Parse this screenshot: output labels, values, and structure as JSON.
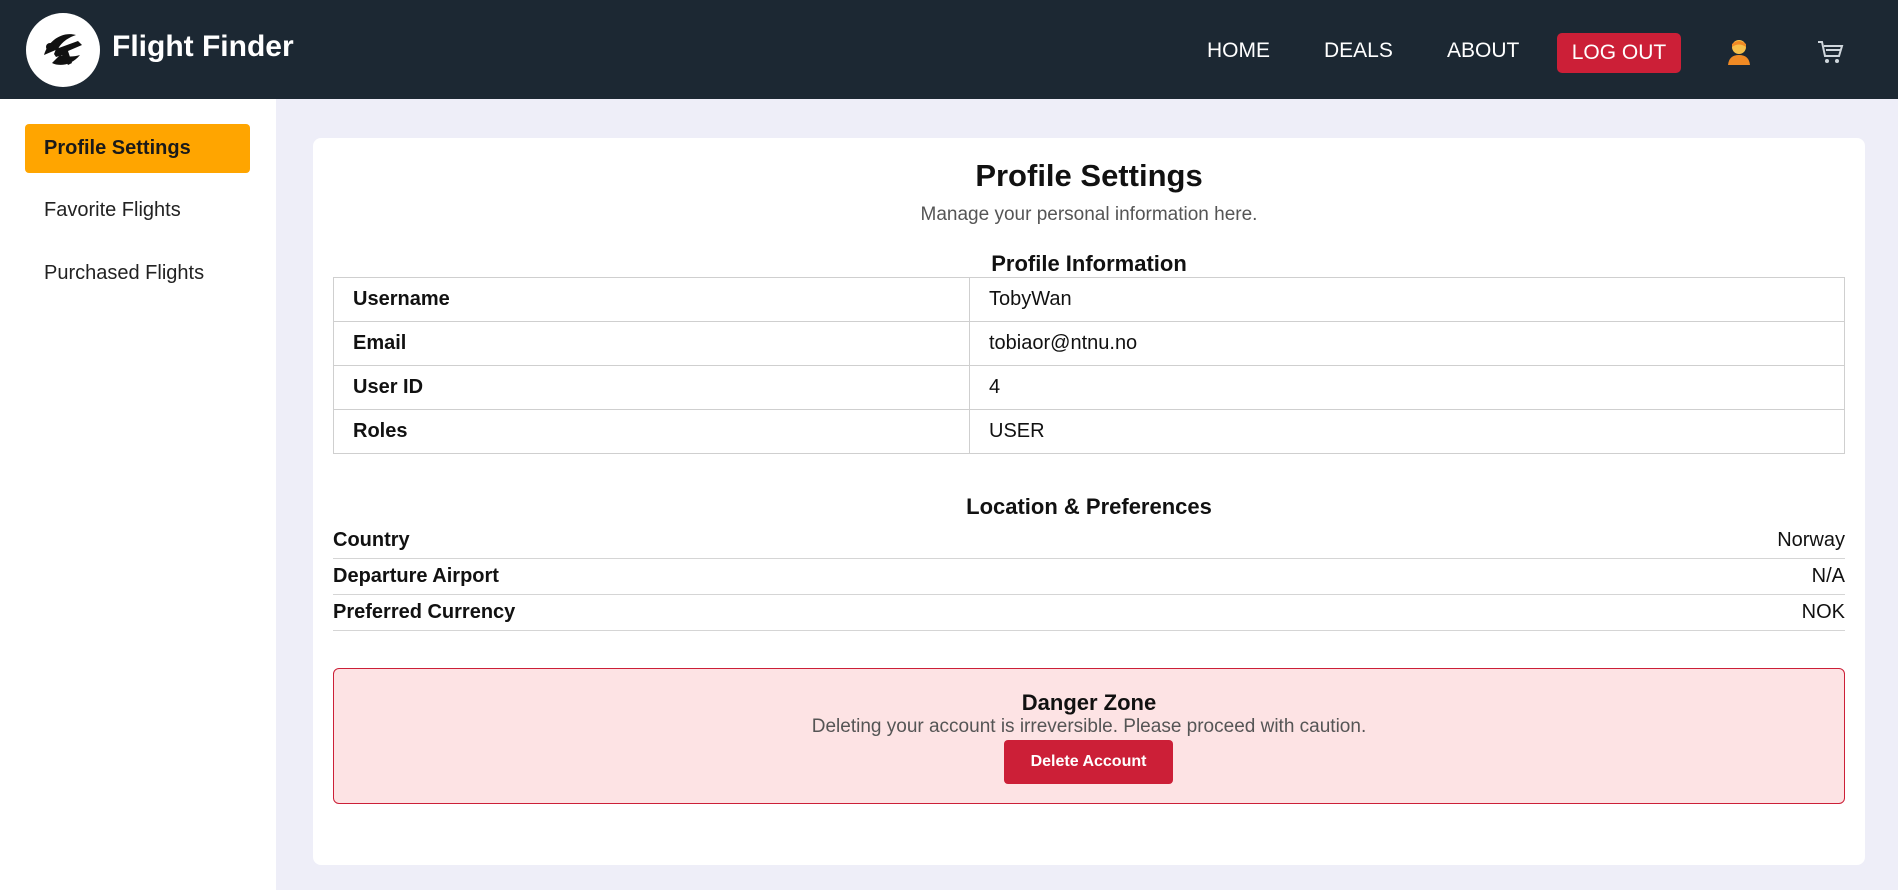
{
  "header": {
    "brand": "Flight Finder",
    "nav": {
      "home": "HOME",
      "deals": "DEALS",
      "about": "ABOUT",
      "logout": "LOG OUT"
    },
    "icons": [
      "airplane-logo-icon",
      "user-icon",
      "cart-icon"
    ],
    "colors": {
      "bar": "#1c2833",
      "logout": "#cc1f37"
    }
  },
  "sidebar": {
    "items": [
      {
        "label": "Profile Settings",
        "active": true
      },
      {
        "label": "Favorite Flights",
        "active": false
      },
      {
        "label": "Purchased Flights",
        "active": false
      }
    ],
    "active_color": "#ffa500"
  },
  "main": {
    "title": "Profile Settings",
    "subtitle": "Manage your personal information here.",
    "profile_section": "Profile Information",
    "profile": [
      {
        "label": "Username",
        "value": "TobyWan"
      },
      {
        "label": "Email",
        "value": "tobiaor@ntnu.no"
      },
      {
        "label": "User ID",
        "value": "4"
      },
      {
        "label": "Roles",
        "value": "USER"
      }
    ],
    "location_section": "Location & Preferences",
    "preferences": [
      {
        "label": "Country",
        "value": "Norway"
      },
      {
        "label": "Departure Airport",
        "value": "N/A"
      },
      {
        "label": "Preferred Currency",
        "value": "NOK"
      }
    ],
    "danger": {
      "title": "Danger Zone",
      "text": "Deleting your account is irreversible. Please proceed with caution.",
      "button": "Delete Account"
    }
  }
}
